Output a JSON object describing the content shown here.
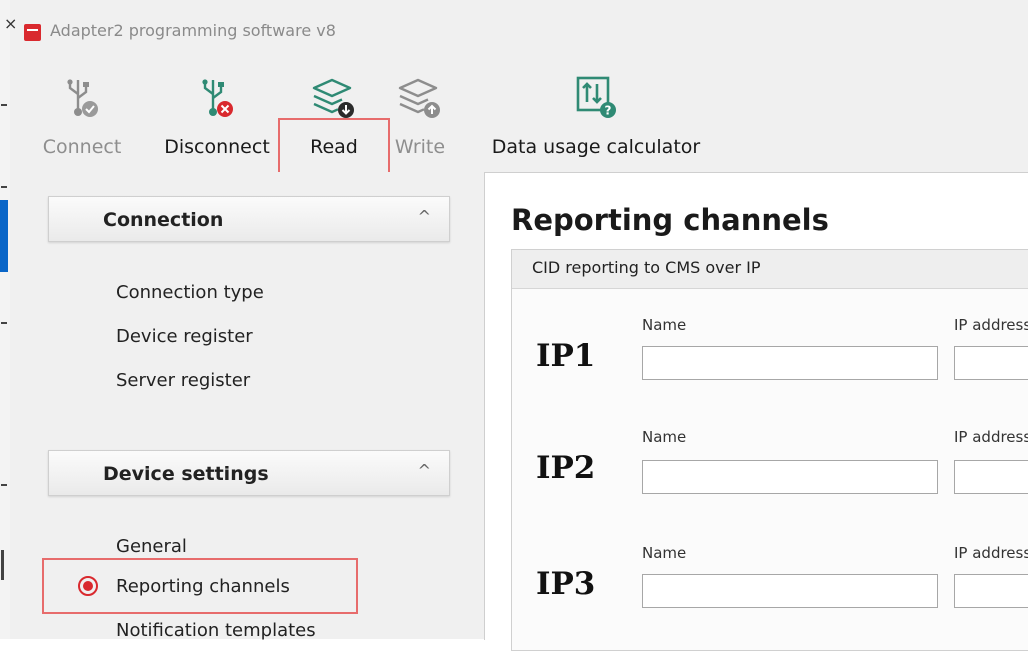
{
  "window": {
    "title": "Adapter2 programming software v8",
    "close_glyph": "×",
    "accent_color": "#d9292e"
  },
  "toolbar": {
    "buttons": [
      {
        "label": "Connect",
        "icon": "usb-connect-icon",
        "enabled": false
      },
      {
        "label": "Disconnect",
        "icon": "usb-disconnect-icon",
        "enabled": true
      },
      {
        "label": "Read",
        "icon": "layers-read-icon",
        "enabled": true,
        "highlighted": true
      },
      {
        "label": "Write",
        "icon": "layers-write-icon",
        "enabled": false
      },
      {
        "label": "Data usage calculator",
        "icon": "data-calculator-icon",
        "enabled": true
      }
    ]
  },
  "sidebar": {
    "groups": [
      {
        "title": "Connection",
        "chevron": "^",
        "items": [
          {
            "label": "Connection type"
          },
          {
            "label": "Device register"
          },
          {
            "label": "Server register"
          }
        ]
      },
      {
        "title": "Device settings",
        "chevron": "^",
        "items": [
          {
            "label": "General"
          },
          {
            "label": "Reporting channels",
            "selected": true
          },
          {
            "label": "Notification templates"
          }
        ]
      }
    ]
  },
  "main": {
    "title": "Reporting channels",
    "section_title": "CID reporting to CMS over IP",
    "channels": [
      {
        "label": "IP1",
        "name_label": "Name",
        "ip_label": "IP address",
        "name_value": "",
        "ip_value": ""
      },
      {
        "label": "IP2",
        "name_label": "Name",
        "ip_label": "IP address",
        "name_value": "",
        "ip_value": ""
      },
      {
        "label": "IP3",
        "name_label": "Name",
        "ip_label": "IP address",
        "name_value": "",
        "ip_value": ""
      }
    ]
  }
}
